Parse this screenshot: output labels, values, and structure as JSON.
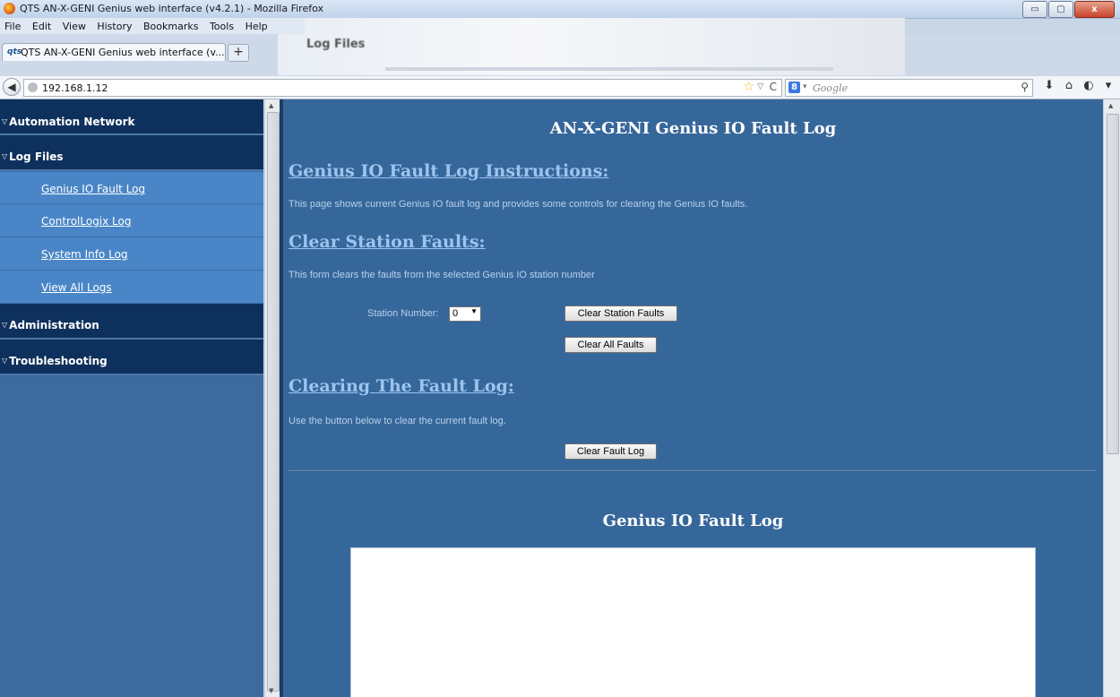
{
  "window": {
    "title": "QTS AN-X-GENI Genius web interface (v4.2.1) - Mozilla Firefox",
    "minimize": "▭",
    "maximize": "▢",
    "close": "x"
  },
  "menu": {
    "file": "File",
    "edit": "Edit",
    "view": "View",
    "history": "History",
    "bookmarks": "Bookmarks",
    "tools": "Tools",
    "help": "Help"
  },
  "background_window": {
    "title": "Log Files"
  },
  "tab": {
    "icon_text": "qts",
    "label": "QTS AN-X-GENI Genius web interface (v...",
    "new_tab": "+"
  },
  "navbar": {
    "url": "192.168.1.12",
    "search_placeholder": "Google",
    "search_engine_letter": "8"
  },
  "sidebar": {
    "sections": [
      {
        "label": "Automation Network"
      },
      {
        "label": "Log Files"
      },
      {
        "label": "Administration"
      },
      {
        "label": "Troubleshooting"
      }
    ],
    "log_items": [
      {
        "label": "Genius IO Fault Log"
      },
      {
        "label": "ControlLogix Log"
      },
      {
        "label": "System Info Log"
      },
      {
        "label": "View All Logs"
      }
    ]
  },
  "main": {
    "page_title": "AN-X-GENI Genius IO Fault Log",
    "instructions_heading": "Genius IO Fault Log Instructions:",
    "instructions_text": "This page shows current Genius IO fault log and provides some controls for clearing the Genius IO faults.",
    "clear_station_heading": "Clear Station Faults:",
    "clear_station_text": "This form clears the faults from the selected Genius IO station number",
    "station_label": "Station Number:",
    "station_value": "0",
    "clear_station_button": "Clear Station Faults",
    "clear_all_button": "Clear All Faults",
    "clearing_log_heading": "Clearing The Fault Log:",
    "clearing_log_text": "Use the button below to clear the current fault log.",
    "clear_log_button": "Clear Fault Log",
    "log_title": "Genius IO Fault Log"
  },
  "colors": {
    "sidebar_section": "#0e305c",
    "sidebar_item": "#4a86c7",
    "main_background": "#36679b",
    "heading_link": "#9cc4ee"
  }
}
